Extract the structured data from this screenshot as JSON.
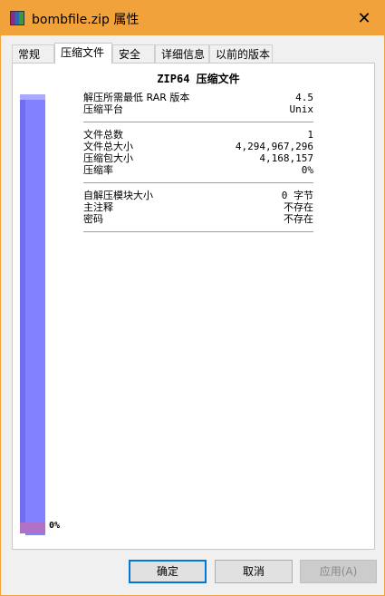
{
  "window": {
    "title": "bombfile.zip 属性",
    "close_glyph": "✕"
  },
  "tabs": [
    {
      "label": "常规"
    },
    {
      "label": "压缩文件",
      "active": true
    },
    {
      "label": "安全"
    },
    {
      "label": "详细信息"
    },
    {
      "label": "以前的版本"
    }
  ],
  "archive": {
    "heading": "ZIP64 压缩文件",
    "group1": [
      {
        "label": "解压所需最低 RAR 版本",
        "value": "4.5"
      },
      {
        "label": "压缩平台",
        "value": "Unix"
      }
    ],
    "group2": [
      {
        "label": "文件总数",
        "value": "1"
      },
      {
        "label": "文件总大小",
        "value": "4,294,967,296"
      },
      {
        "label": "压缩包大小",
        "value": "4,168,157"
      },
      {
        "label": "压缩率",
        "value": "0%"
      }
    ],
    "group3": [
      {
        "label": "自解压模块大小",
        "value": "0 字节"
      },
      {
        "label": "主注释",
        "value": "不存在"
      },
      {
        "label": "密码",
        "value": "不存在"
      }
    ]
  },
  "ratio_bar": {
    "label": "0%",
    "fill_fraction": 0.0,
    "colors": {
      "bar": "#8282ff",
      "fill": "#b070c8"
    }
  },
  "buttons": {
    "ok": "确定",
    "cancel": "取消",
    "apply": "应用(A)"
  }
}
